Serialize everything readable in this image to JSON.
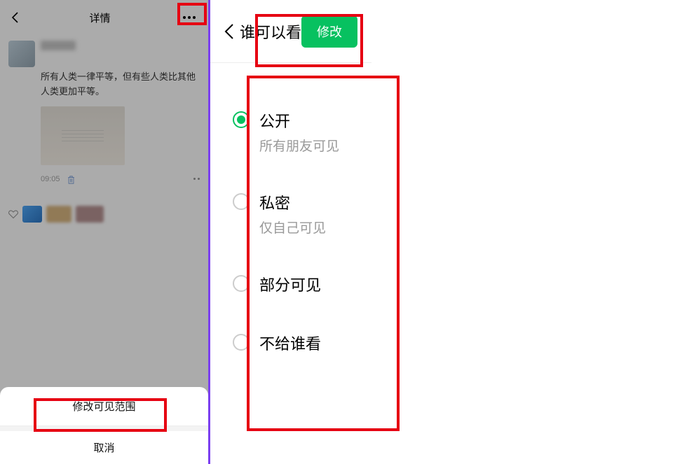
{
  "left": {
    "header_title": "详情",
    "post_text": "所有人类一律平等，但有些人类比其他人类更加平等。",
    "timestamp": "09:05",
    "sheet": {
      "modify_visibility": "修改可见范围",
      "cancel": "取消"
    }
  },
  "right": {
    "header_title": "谁可以看",
    "modify_button": "修改",
    "options": [
      {
        "title": "公开",
        "subtitle": "所有朋友可见",
        "selected": true
      },
      {
        "title": "私密",
        "subtitle": "仅自己可见",
        "selected": false
      },
      {
        "title": "部分可见",
        "subtitle": "",
        "selected": false
      },
      {
        "title": "不给谁看",
        "subtitle": "",
        "selected": false
      }
    ]
  }
}
